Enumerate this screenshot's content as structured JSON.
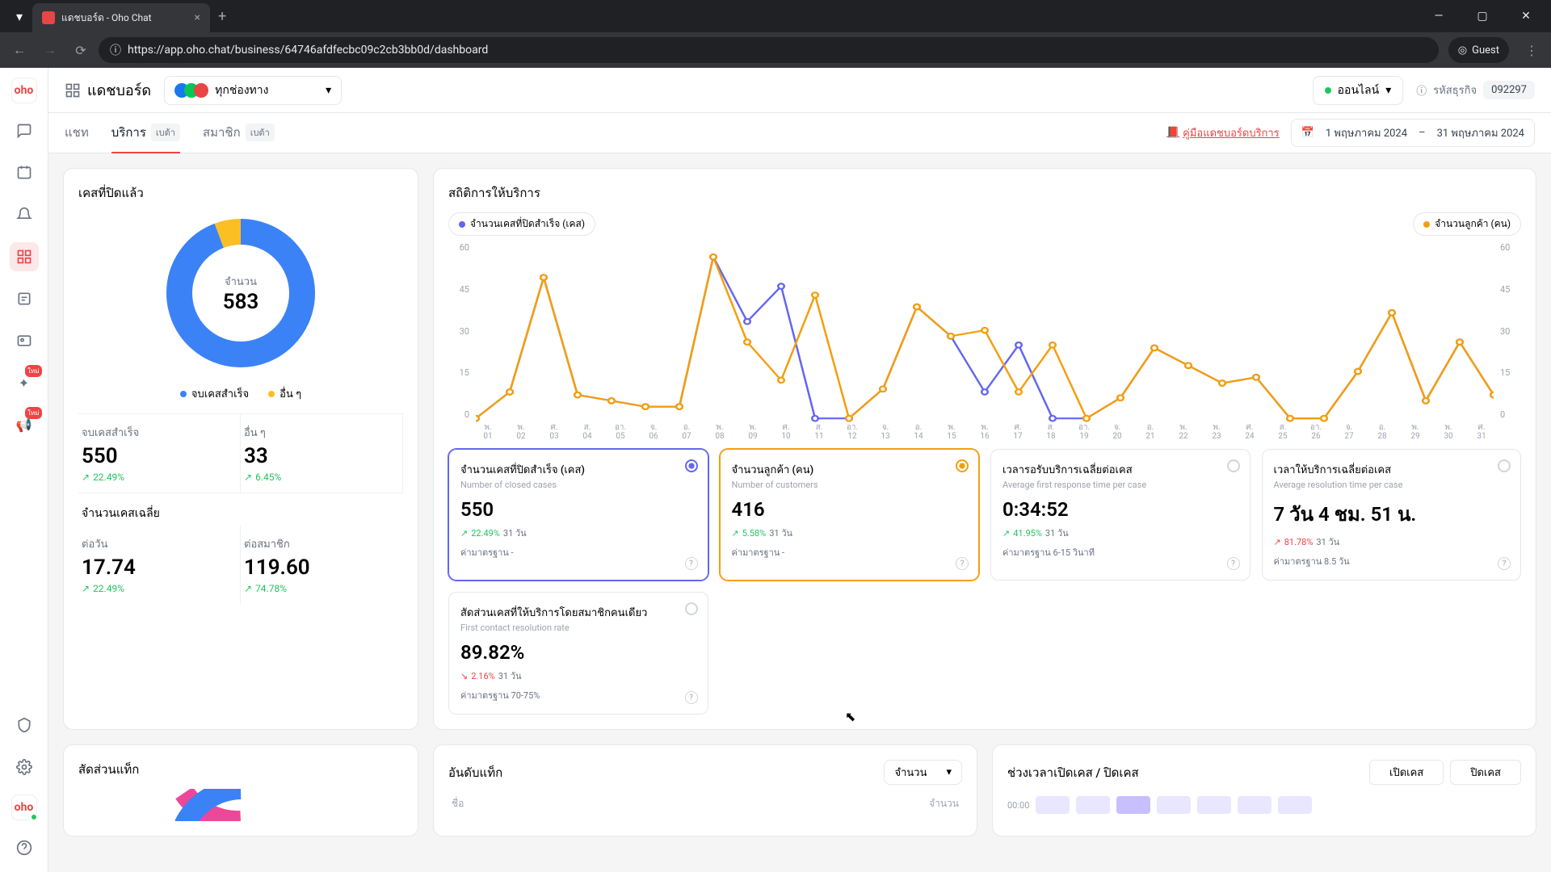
{
  "browser": {
    "tab_title": "แดชบอร์ด - Oho Chat",
    "url": "https://app.oho.chat/business/64746afdfecbc09c2cb3bb0d/dashboard",
    "guest": "Guest"
  },
  "topbar": {
    "title": "แดชบอร์ด",
    "channel_label": "ทุกช่องทาง",
    "status": "ออนไลน์",
    "biz_code_label": "รหัสธุรกิจ",
    "biz_code": "092297"
  },
  "tabs": {
    "chat": "แชท",
    "service": "บริการ",
    "member": "สมาชิก",
    "beta": "เบต้า",
    "manual": "คู่มือแดชบอร์ดบริการ",
    "date_from": "1 พฤษภาคม 2024",
    "date_to": "31 พฤษภาคม 2024"
  },
  "closed": {
    "title": "เคสที่ปิดแล้ว",
    "center_label": "จำนวน",
    "total": "583",
    "leg_success": "จบเคสสำเร็จ",
    "leg_other": "อื่น ๆ",
    "success_label": "จบเคสสำเร็จ",
    "success_val": "550",
    "success_pct": "22.49%",
    "other_label": "อื่น ๆ",
    "other_val": "33",
    "other_pct": "6.45%",
    "avg_title": "จำนวนเคสเฉลี่ย",
    "per_day_label": "ต่อวัน",
    "per_day_val": "17.74",
    "per_day_pct": "22.49%",
    "per_member_label": "ต่อสมาชิก",
    "per_member_val": "119.60",
    "per_member_pct": "74.78%"
  },
  "stats": {
    "title": "สถิติการให้บริการ",
    "leg_closed": "จำนวนเคสที่ปิดสำเร็จ (เคส)",
    "leg_cust": "จำนวนลูกค้า (คน)",
    "y_ticks": [
      "60",
      "45",
      "30",
      "15",
      "0"
    ]
  },
  "metrics": {
    "m1": {
      "title": "จำนวนเคสที่ปิดสำเร็จ (เคส)",
      "sub": "Number of closed cases",
      "val": "550",
      "pct": "22.49%",
      "days": "31 วัน",
      "std": "ค่ามาตรฐาน -"
    },
    "m2": {
      "title": "จำนวนลูกค้า (คน)",
      "sub": "Number of customers",
      "val": "416",
      "pct": "5.58%",
      "days": "31 วัน",
      "std": "ค่ามาตรฐาน -"
    },
    "m3": {
      "title": "เวลารอรับบริการเฉลี่ยต่อเคส",
      "sub": "Average first response time per case",
      "val": "0:34:52",
      "pct": "41.95%",
      "days": "31 วัน",
      "std": "ค่ามาตรฐาน 6-15 วินาที"
    },
    "m4": {
      "title": "เวลาให้บริการเฉลี่ยต่อเคส",
      "sub": "Average resolution time per case",
      "val": "7 วัน 4 ชม. 51 น.",
      "pct": "81.78%",
      "days": "31 วัน",
      "std": "ค่ามาตรฐาน 8.5 วัน"
    },
    "m5": {
      "title": "สัดส่วนเคสที่ให้บริการโดยสมาชิกคนเดียว",
      "sub": "First contact resolution rate",
      "val": "89.82%",
      "pct": "2.16%",
      "days": "31 วัน",
      "std": "ค่ามาตรฐาน 70-75%"
    }
  },
  "bottom": {
    "tags_title": "สัดส่วนแท็ก",
    "rank_title": "อันดับแท็ก",
    "rank_sort": "จำนวน",
    "rank_col1": "ชื่อ",
    "rank_col2": "จำนวน",
    "time_title": "ช่วงเวลาเปิดเคส / ปิดเคส",
    "time_axis": "00:00",
    "btn_open": "เปิดเคส",
    "btn_close": "ปิดเคส"
  },
  "chart_data": {
    "type": "line",
    "x": [
      "01",
      "02",
      "03",
      "04",
      "05",
      "06",
      "07",
      "08",
      "09",
      "10",
      "11",
      "12",
      "13",
      "14",
      "15",
      "16",
      "17",
      "18",
      "19",
      "20",
      "21",
      "22",
      "23",
      "24",
      "25",
      "26",
      "27",
      "28",
      "29",
      "30",
      "31"
    ],
    "x_dow": [
      "พ.",
      "พ.",
      "ศ.",
      "ส.",
      "อา.",
      "จ.",
      "อ.",
      "พ.",
      "พ.",
      "ศ.",
      "ส.",
      "อา.",
      "จ.",
      "อ.",
      "พ.",
      "พ.",
      "ศ.",
      "ส.",
      "อา.",
      "จ.",
      "อ.",
      "พ.",
      "พ.",
      "ศ.",
      "ส.",
      "อา.",
      "จ.",
      "อ.",
      "พ.",
      "พ.",
      "ศ."
    ],
    "ylim": [
      0,
      60
    ],
    "series": [
      {
        "name": "closed",
        "color": "#6366f1",
        "values": [
          0,
          9,
          48,
          8,
          6,
          4,
          4,
          55,
          33,
          45,
          0,
          0,
          10,
          38,
          28,
          9,
          25,
          0,
          0,
          7,
          24,
          18,
          12,
          14,
          0,
          0,
          16,
          36,
          6,
          26,
          8
        ]
      },
      {
        "name": "customers",
        "color": "#f59e0b",
        "values": [
          0,
          9,
          48,
          8,
          6,
          4,
          4,
          55,
          26,
          13,
          42,
          0,
          10,
          38,
          28,
          30,
          9,
          25,
          0,
          7,
          24,
          18,
          12,
          14,
          0,
          0,
          16,
          36,
          6,
          26,
          8
        ]
      }
    ]
  }
}
